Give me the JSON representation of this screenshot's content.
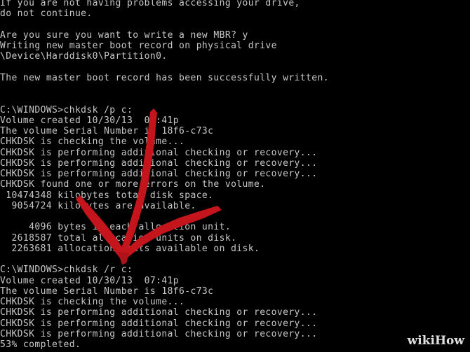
{
  "console": {
    "lines": [
      "If you are not having problems accessing your drive,",
      "do not continue.",
      "",
      "Are you sure you want to write a new MBR? y",
      "Writing new master boot record on physical drive",
      "\\Device\\Harddisk0\\Partition0.",
      "",
      "The new master boot record has been successfully written.",
      "",
      "",
      "C:\\WINDOWS>chkdsk /p c:",
      "Volume created 10/30/13  07:41p",
      "The volume Serial Number is 18f6-c73c",
      "CHKDSK is checking the volume...",
      "CHKDSK is performing additional checking or recovery...",
      "CHKDSK is performing additional checking or recovery...",
      "CHKDSK is performing additional checking or recovery...",
      "CHKDSK found one or more errors on the volume.",
      " 10474348 kilobytes total disk space.",
      "  9054724 kilobytes are available.",
      "",
      "     4096 bytes in each allocation unit.",
      "  2618587 total allocation units on disk.",
      "  2263681 allocation units available on disk.",
      "",
      "C:\\WINDOWS>chkdsk /r c:",
      "Volume created 10/30/13  07:41p",
      "The volume Serial Number is 18f6-c73c",
      "CHKDSK is checking the volume...",
      "CHKDSK is performing additional checking or recovery...",
      "CHKDSK is performing additional checking or recovery...",
      "CHKDSK is performing additional checking or recovery...",
      "53% completed."
    ]
  },
  "colors": {
    "background": "#000000",
    "text": "#c8c8c8",
    "arrow": "#c4141c"
  },
  "watermark": {
    "text": "wikiHow"
  }
}
